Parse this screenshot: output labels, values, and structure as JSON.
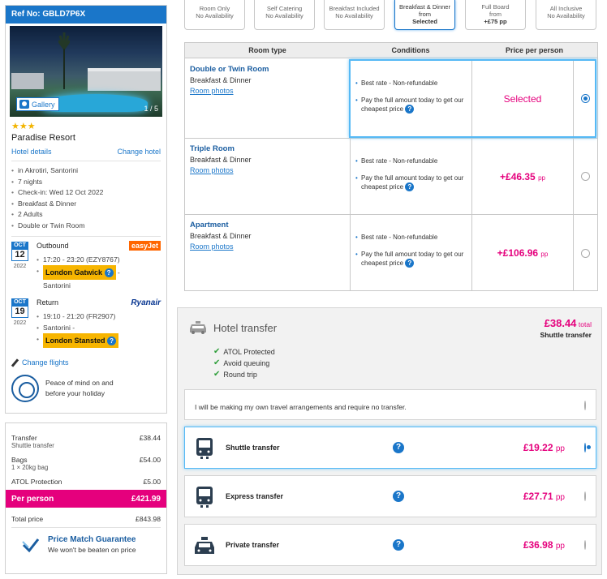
{
  "booking": {
    "ref_label": "Ref No: GBLD7P6X",
    "gallery_label": "Gallery",
    "photo_counter": "1 / 5",
    "stars": "★★★",
    "hotel_name": "Paradise Resort",
    "hotel_details_link": "Hotel details",
    "change_hotel_link": "Change hotel",
    "info": [
      "in Akrotiri, Santorini",
      "7 nights",
      "Check-in: Wed 12 Oct 2022",
      "Breakfast & Dinner",
      "2 Adults",
      "Double or Twin Room"
    ]
  },
  "flights": {
    "outbound": {
      "month": "OCT",
      "day": "12",
      "year": "2022",
      "title": "Outbound",
      "airline": "easyJet",
      "time": "17:20 - 23:20 (EZY8767)",
      "airport": "London Gatwick",
      "dash": "-",
      "destination": "Santorini"
    },
    "return": {
      "month": "OCT",
      "day": "19",
      "year": "2022",
      "title": "Return",
      "airline": "Ryanair",
      "time": "19:10 - 21:20 (FR2907)",
      "origin": "Santorini -",
      "airport": "London Stansted"
    },
    "change_flights_link": "Change flights",
    "atol_text": "Peace of mind on and before your holiday"
  },
  "price_summary": {
    "transfer_label": "Transfer",
    "transfer_value": "£38.44",
    "transfer_sub": "Shuttle transfer",
    "bags_label": "Bags",
    "bags_value": "£54.00",
    "bags_sub": "1 × 20kg bag",
    "atol_label": "ATOL Protection",
    "atol_value": "£5.00",
    "per_person_label": "Per person",
    "per_person_value": "£421.99",
    "total_label": "Total price",
    "total_value": "£843.98",
    "pm_title": "Price Match Guarantee",
    "pm_sub": "We won't be beaten on price"
  },
  "board_tabs": [
    {
      "line1": "Room Only",
      "line2": "No Availability",
      "line3": ""
    },
    {
      "line1": "Self Catering",
      "line2": "No Availability",
      "line3": ""
    },
    {
      "line1": "Breakfast Included",
      "line2": "No Availability",
      "line3": ""
    },
    {
      "line1": "Breakfast & Dinner",
      "line2": "from",
      "line3": "Selected"
    },
    {
      "line1": "Full Board",
      "line2": "from",
      "line3": "+£75 pp"
    },
    {
      "line1": "All Inclusive",
      "line2": "No Availability",
      "line3": ""
    }
  ],
  "room_table": {
    "headers": {
      "room_type": "Room type",
      "conditions": "Conditions",
      "price": "Price per person"
    },
    "rooms": [
      {
        "name": "Double or Twin Room",
        "board": "Breakfast & Dinner",
        "photos": "Room photos",
        "cond1": "Best rate - Non-refundable",
        "cond2": "Pay the full amount today to get our cheapest price",
        "price": "Selected",
        "pp": ""
      },
      {
        "name": "Triple Room",
        "board": "Breakfast & Dinner",
        "photos": "Room photos",
        "cond1": "Best rate - Non-refundable",
        "cond2": "Pay the full amount today to get our cheapest price",
        "price": "+£46.35",
        "pp": "pp"
      },
      {
        "name": "Apartment",
        "board": "Breakfast & Dinner",
        "photos": "Room photos",
        "cond1": "Best rate - Non-refundable",
        "cond2": "Pay the full amount today to get our cheapest price",
        "price": "+£106.96",
        "pp": "pp"
      }
    ]
  },
  "transfer": {
    "title": "Hotel transfer",
    "total_amount": "£38.44",
    "total_label": "total",
    "kind": "Shuttle transfer",
    "benefits": [
      "ATOL Protected",
      "Avoid queuing",
      "Round trip"
    ],
    "own_arrangements": "I will be making my own travel arrangements and require no transfer.",
    "options": [
      {
        "name": "Shuttle transfer",
        "price": "£19.22",
        "pp": "pp"
      },
      {
        "name": "Express transfer",
        "price": "£27.71",
        "pp": "pp"
      },
      {
        "name": "Private transfer",
        "price": "£36.98",
        "pp": "pp"
      }
    ]
  },
  "colors": {
    "brand_blue": "#1a76c9",
    "accent_pink": "#e5007d",
    "airport_yellow": "#f7b500"
  }
}
